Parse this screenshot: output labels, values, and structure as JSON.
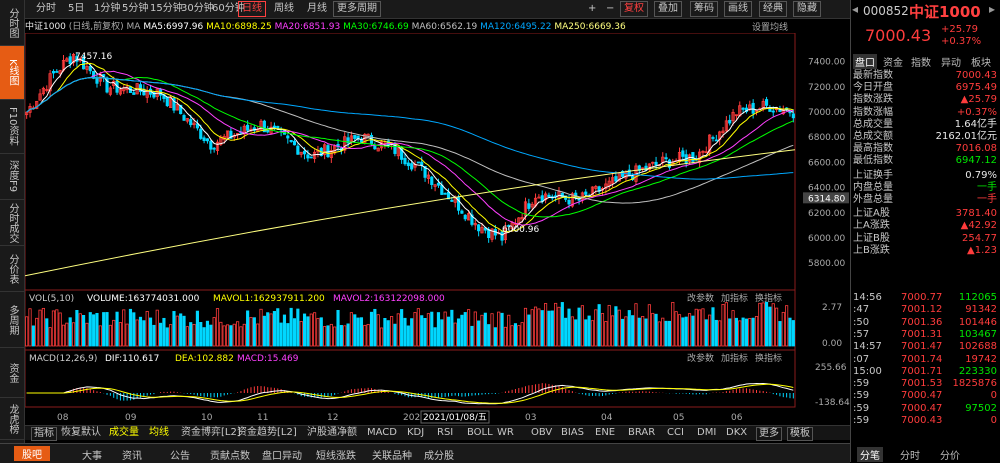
{
  "left_nav": [
    "分时图",
    "K线图",
    "F10资料",
    "深度F9",
    "分时成交",
    "分价表",
    "多周期",
    "资金",
    "龙虎榜"
  ],
  "toolbar": {
    "periods": [
      "分时",
      "5日",
      "1分钟",
      "5分钟",
      "15分钟",
      "30分钟",
      "60分钟",
      "日线",
      "周线",
      "月线",
      "更多周期"
    ],
    "right_buttons": [
      "+",
      "−",
      "复权",
      "叠加",
      "筹码",
      "画线",
      "经典",
      "隐藏"
    ]
  },
  "info": {
    "name": "中证1000",
    "mode": "(日线,前复权)",
    "ma5": "MA5:6997.96",
    "ma10": "MA10:6898.25",
    "ma20": "MA20:6851.93",
    "ma30": "MA30:6746.69",
    "ma60": "MA60:6562.19",
    "ma120": "MA120:6495.22",
    "ma250": "MA250:6669.36",
    "settings": "设置均线"
  },
  "price_axis": [
    "7400.00",
    "7200.00",
    "7000.00",
    "6800.00",
    "6600.00",
    "6400.00",
    "6314.80",
    "6200.00",
    "6000.00",
    "5800.00"
  ],
  "annotations": {
    "high": "7457.16",
    "low": "6000.96"
  },
  "vol": {
    "label": "VOL(5,10)",
    "volume": "VOLUME:163774031.000",
    "mavol1": "MAVOL1:162937911.200",
    "mavol2": "MAVOL2:163122098.000",
    "axis": [
      "2.77",
      "0.00"
    ],
    "tools": [
      "改参数",
      "加指标",
      "换指标"
    ]
  },
  "macd": {
    "label": "MACD(12,26,9)",
    "dif": "DIF:110.617",
    "dea": "DEA:102.882",
    "macd": "MACD:15.469",
    "axis": [
      "255.66",
      "-138.64"
    ],
    "tools": [
      "改参数",
      "加指标",
      "换指标"
    ]
  },
  "x_axis": [
    "08",
    "09",
    "10",
    "11",
    "12",
    "202",
    "2021/01/08/五",
    "03",
    "04",
    "05",
    "06"
  ],
  "bottom_tabs": [
    "指标",
    "恢复默认",
    "成交量",
    "均线",
    "资金博弈[L2]",
    "资金趋势[L2]",
    "沪股通净额",
    "MACD",
    "KDJ",
    "RSI",
    "BOLL",
    "WR",
    "OBV",
    "BIAS",
    "ENE",
    "BRAR",
    "CCI",
    "DMI",
    "DKX",
    "更多",
    "模板"
  ],
  "footer": [
    "股吧",
    "大事",
    "资讯",
    "公告",
    "贡献点数",
    "盘口异动",
    "短线涨跌",
    "关联品种",
    "成分股"
  ],
  "quote": {
    "code": "000852",
    "name": "中证1000",
    "price": "7000.43",
    "chg": "+25.79",
    "pct": "+0.37%",
    "tabs": [
      "盘口",
      "资金",
      "指数",
      "异动",
      "板块"
    ],
    "rows": [
      {
        "k": "最新指数",
        "v": "7000.43",
        "c": "red"
      },
      {
        "k": "今日开盘",
        "v": "6975.49",
        "c": "red"
      },
      {
        "k": "指数涨跌",
        "v": "▲25.79",
        "c": "red"
      },
      {
        "k": "指数涨幅",
        "v": "+0.37%",
        "c": "red"
      },
      {
        "k": "总成交量",
        "v": "1.64亿手",
        "c": "white"
      },
      {
        "k": "总成交额",
        "v": "2162.01亿元",
        "c": "white"
      },
      {
        "k": "最高指数",
        "v": "7016.08",
        "c": "red"
      },
      {
        "k": "最低指数",
        "v": "6947.12",
        "c": "green"
      },
      {
        "k": "上证换手",
        "v": "0.79%",
        "c": "white"
      },
      {
        "k": "内盘总量",
        "v": "一手",
        "c": "green"
      },
      {
        "k": "外盘总量",
        "v": "一手",
        "c": "red"
      },
      {
        "k": "上证A股",
        "v": "3781.40",
        "c": "red"
      },
      {
        "k": "上A涨跌",
        "v": "▲42.92",
        "c": "red"
      },
      {
        "k": "上证B股",
        "v": "254.77",
        "c": "red"
      },
      {
        "k": "上B涨跌",
        "v": "▲1.23",
        "c": "red"
      }
    ],
    "ticks": [
      {
        "t": "14:56",
        "p": "7000.77",
        "v": "112065"
      },
      {
        "t": ":47",
        "p": "7001.12",
        "v": "91342"
      },
      {
        "t": ":50",
        "p": "7001.36",
        "v": "101446"
      },
      {
        "t": ":57",
        "p": "7001.31",
        "v": "103467"
      },
      {
        "t": "14:57",
        "p": "7001.47",
        "v": "102688"
      },
      {
        "t": ":07",
        "p": "7001.74",
        "v": "19742"
      },
      {
        "t": "15:00",
        "p": "7001.71",
        "v": "223330"
      },
      {
        "t": ":59",
        "p": "7001.53",
        "v": "1825876"
      },
      {
        "t": ":59",
        "p": "7000.47",
        "v": "0"
      },
      {
        "t": ":59",
        "p": "7000.47",
        "v": "97502"
      },
      {
        "t": ":59",
        "p": "7000.43",
        "v": "0"
      }
    ],
    "bottom_tabs": [
      "分笔",
      "分时",
      "分价"
    ]
  },
  "colors": {
    "up": "#ff3c3c",
    "down": "#00d7ff",
    "ma5": "#ffffff",
    "ma10": "#ffff00",
    "ma20": "#ff40ff",
    "ma30": "#00ff00",
    "ma60": "#c0c0c0",
    "ma120": "#00a8ff",
    "ma250": "#ffff80"
  }
}
